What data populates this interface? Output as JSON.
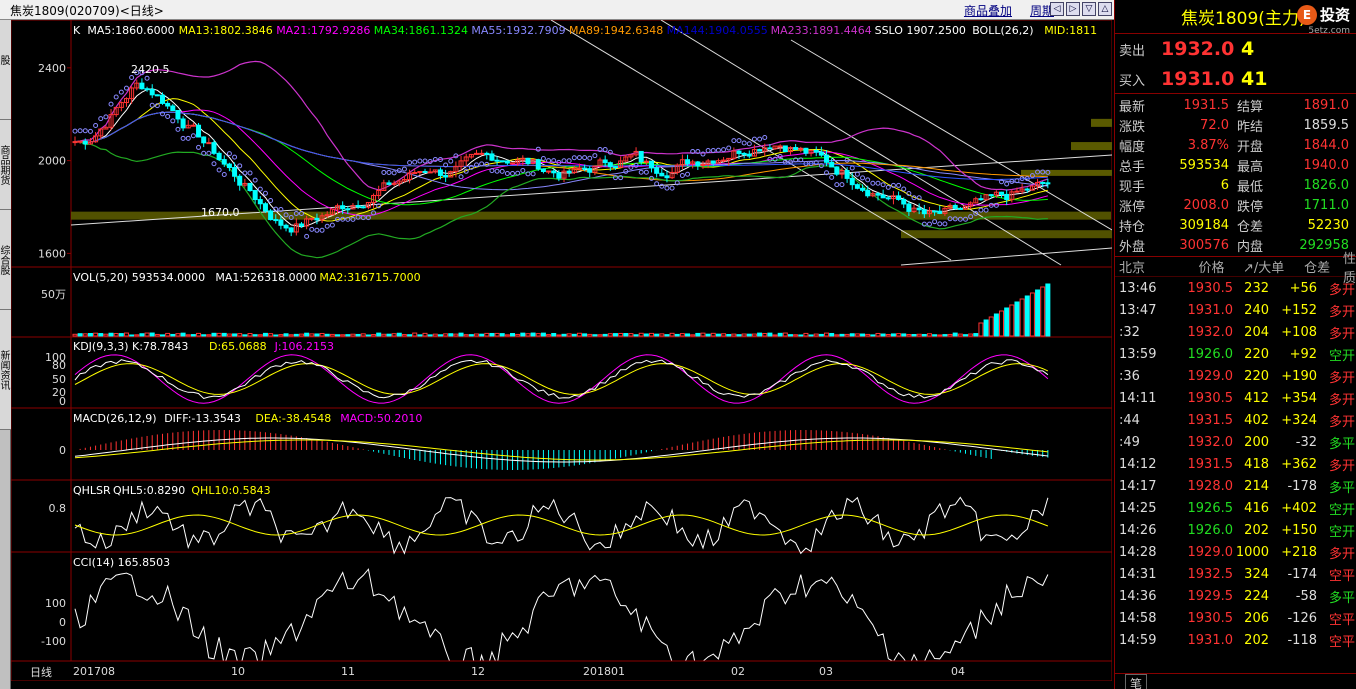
{
  "window": {
    "title": "焦炭1809(020709)<日线>",
    "links": [
      "商品叠加",
      "周期"
    ],
    "nav_buttons": [
      "◁",
      "▷",
      "▽",
      "△"
    ]
  },
  "left_tabs": [
    "股",
    "商品期货",
    "综合股",
    "新闻资讯"
  ],
  "main_chart": {
    "indicator_line": [
      {
        "text": "K",
        "color": "#ffffff"
      },
      {
        "text": "MA5:1860.6000",
        "color": "#ffffff"
      },
      {
        "text": "MA13:1802.3846",
        "color": "#ffff00"
      },
      {
        "text": "MA21:1792.9286",
        "color": "#ff00ff"
      },
      {
        "text": "MA34:1861.1324",
        "color": "#00ff00"
      },
      {
        "text": "MA55:1932.7909",
        "color": "#8888ff"
      },
      {
        "text": "MA89:1942.6348",
        "color": "#ff9900"
      },
      {
        "text": "MA144:1904.0555",
        "color": "#0000cc"
      },
      {
        "text": "MA233:1891.4464",
        "color": "#cc33cc"
      },
      {
        "text": "SSLO 1907.2500",
        "color": "#ffffff"
      },
      {
        "text": "BOLL(26,2)",
        "color": "#ffffff"
      },
      {
        "text": "MID:1811",
        "color": "#ffff00"
      }
    ],
    "y_ticks": [
      "2400",
      "2000",
      "1600"
    ],
    "high_label": "2420.5",
    "low_label": "1670.0"
  },
  "vol_panel": {
    "indicator_line": [
      {
        "text": "VOL(5,20) 593534.0000",
        "color": "#ffffff"
      },
      {
        "text": "MA1:526318.0000",
        "color": "#ffffff"
      },
      {
        "text": "MA2:316715.7000",
        "color": "#ffff00"
      }
    ],
    "y_ticks": [
      "50万"
    ]
  },
  "kdj_panel": {
    "indicator_line": [
      {
        "text": "KDJ(9,3,3) K:78.7843",
        "color": "#ffffff"
      },
      {
        "text": "D:65.0688",
        "color": "#ffff00"
      },
      {
        "text": "J:106.2153",
        "color": "#ff00ff"
      }
    ],
    "y_ticks": [
      "100",
      "80",
      "50",
      "20",
      "0"
    ]
  },
  "macd_panel": {
    "indicator_line": [
      {
        "text": "MACD(26,12,9)",
        "color": "#ffffff"
      },
      {
        "text": "DIFF:-13.3543",
        "color": "#ffffff"
      },
      {
        "text": "DEA:-38.4548",
        "color": "#ffff00"
      },
      {
        "text": "MACD:50.2010",
        "color": "#ff00ff"
      }
    ],
    "y_ticks": [
      "0"
    ]
  },
  "qhlsr_panel": {
    "indicator_line": [
      {
        "text": "QHLSR",
        "color": "#ffffff"
      },
      {
        "text": "QHL5:0.8290",
        "color": "#ffffff"
      },
      {
        "text": "QHL10:0.5843",
        "color": "#ffff00"
      }
    ],
    "y_ticks": [
      "0.8"
    ]
  },
  "cci_panel": {
    "indicator_line": [
      {
        "text": "CCI(14) 165.8503",
        "color": "#ffffff"
      }
    ],
    "y_ticks": [
      "100",
      "0",
      "-100"
    ]
  },
  "x_axis": {
    "corner_label": "日线",
    "labels": [
      "201708",
      "10",
      "11",
      "12",
      "201801",
      "02",
      "03",
      "04"
    ]
  },
  "quote": {
    "name": "焦炭1809",
    "name_suffix": "(主力)",
    "logo_glyph": "E",
    "logo_text": "投资",
    "logo_site": "5etz.com",
    "ask_label": "卖出",
    "ask_price": "1932.0",
    "ask_vol": "4",
    "bid_label": "买入",
    "bid_price": "1931.0",
    "bid_vol": "41",
    "stats": [
      {
        "k": "最新",
        "v": "1931.5",
        "c": "red",
        "k2": "结算",
        "v2": "1891.0",
        "c2": "red"
      },
      {
        "k": "涨跌",
        "v": "72.0",
        "c": "red",
        "k2": "昨结",
        "v2": "1859.5",
        "c2": "white"
      },
      {
        "k": "幅度",
        "v": "3.87%",
        "c": "red",
        "k2": "开盘",
        "v2": "1844.0",
        "c2": "red"
      },
      {
        "k": "总手",
        "v": "593534",
        "c": "yellow",
        "k2": "最高",
        "v2": "1940.0",
        "c2": "red"
      },
      {
        "k": "现手",
        "v": "6",
        "c": "yellow",
        "k2": "最低",
        "v2": "1826.0",
        "c2": "green"
      },
      {
        "k": "涨停",
        "v": "2008.0",
        "c": "red",
        "k2": "跌停",
        "v2": "1711.0",
        "c2": "green"
      },
      {
        "k": "持仓",
        "v": "309184",
        "c": "yellow",
        "k2": "仓差",
        "v2": "52230",
        "c2": "yellow"
      },
      {
        "k": "外盘",
        "v": "300576",
        "c": "red",
        "k2": "内盘",
        "v2": "292958",
        "c2": "green"
      }
    ],
    "tick_header": [
      "北京",
      "价格",
      "↗/大单",
      "仓差",
      "性质"
    ],
    "ticks": [
      {
        "t": "13:46",
        "p": "1930.5",
        "pc": "red",
        "q": "232",
        "o": "+56",
        "n": "多开",
        "nc": "red"
      },
      {
        "t": "13:47",
        "p": "1931.0",
        "pc": "red",
        "q": "240",
        "o": "+152",
        "n": "多开",
        "nc": "red"
      },
      {
        "t": ":32",
        "p": "1932.0",
        "pc": "red",
        "q": "204",
        "o": "+108",
        "n": "多开",
        "nc": "red"
      },
      {
        "t": "13:59",
        "p": "1926.0",
        "pc": "green",
        "q": "220",
        "o": "+92",
        "n": "空开",
        "nc": "green"
      },
      {
        "t": ":36",
        "p": "1929.0",
        "pc": "red",
        "q": "220",
        "o": "+190",
        "n": "多开",
        "nc": "red"
      },
      {
        "t": "14:11",
        "p": "1930.5",
        "pc": "red",
        "q": "412",
        "o": "+354",
        "n": "多开",
        "nc": "red"
      },
      {
        "t": ":44",
        "p": "1931.5",
        "pc": "red",
        "q": "402",
        "o": "+324",
        "n": "多开",
        "nc": "red"
      },
      {
        "t": ":49",
        "p": "1932.0",
        "pc": "red",
        "q": "200",
        "o": "-32",
        "n": "多平",
        "nc": "green"
      },
      {
        "t": "14:12",
        "p": "1931.5",
        "pc": "red",
        "q": "418",
        "o": "+362",
        "n": "多开",
        "nc": "red"
      },
      {
        "t": "14:17",
        "p": "1928.0",
        "pc": "red",
        "q": "214",
        "o": "-178",
        "n": "多平",
        "nc": "green"
      },
      {
        "t": "14:25",
        "p": "1926.5",
        "pc": "green",
        "q": "416",
        "o": "+402",
        "n": "空开",
        "nc": "green"
      },
      {
        "t": "14:26",
        "p": "1926.0",
        "pc": "green",
        "q": "202",
        "o": "+150",
        "n": "空开",
        "nc": "green"
      },
      {
        "t": "14:28",
        "p": "1929.0",
        "pc": "red",
        "q": "1000",
        "o": "+218",
        "n": "多开",
        "nc": "red"
      },
      {
        "t": "14:31",
        "p": "1932.5",
        "pc": "red",
        "q": "324",
        "o": "-174",
        "n": "空平",
        "nc": "red"
      },
      {
        "t": "14:36",
        "p": "1929.5",
        "pc": "red",
        "q": "224",
        "o": "-58",
        "n": "多平",
        "nc": "green"
      },
      {
        "t": "14:58",
        "p": "1930.5",
        "pc": "red",
        "q": "206",
        "o": "-126",
        "n": "空平",
        "nc": "red"
      },
      {
        "t": "14:59",
        "p": "1931.0",
        "pc": "red",
        "q": "202",
        "o": "-118",
        "n": "空平",
        "nc": "red"
      }
    ],
    "footer_tab": "笔"
  }
}
